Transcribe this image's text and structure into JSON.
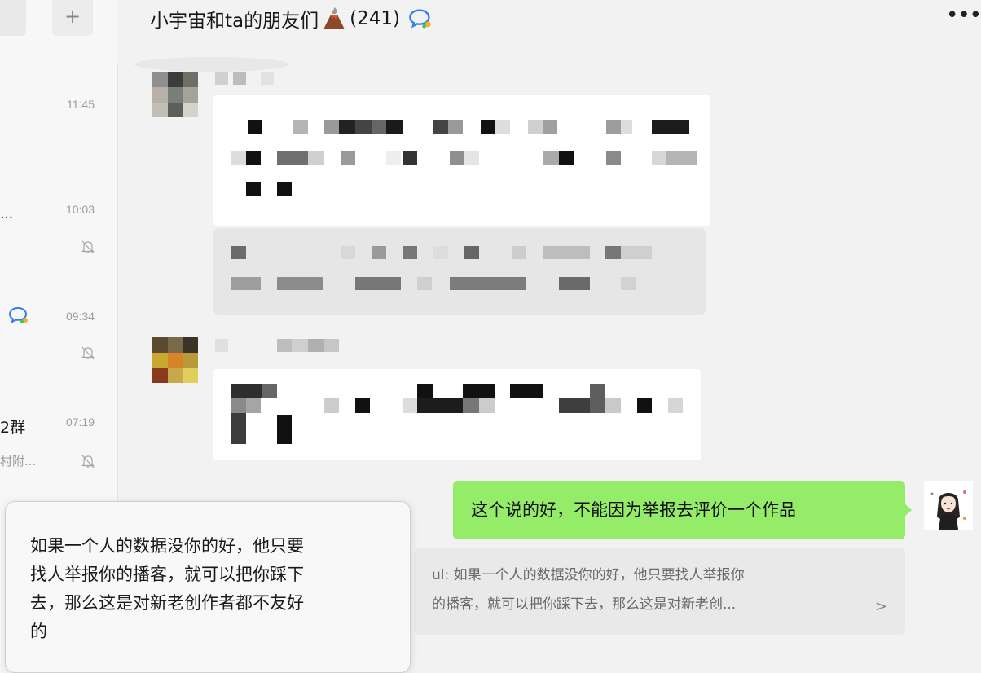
{
  "sidebar": {
    "plus_label": "+",
    "items": [
      {
        "time": "11:45"
      },
      {
        "fragment": "...",
        "time": "10:03"
      },
      {
        "time": "09:34"
      },
      {
        "fragment": "2群",
        "time": "07:19",
        "sub": "村附..."
      }
    ]
  },
  "header": {
    "title": "小宇宙和ta的朋友们",
    "count": "(241)",
    "more": "•••"
  },
  "my_message": {
    "text": "这个说的好，不能因为举报去评价一个作品",
    "quote_line1": "ul: 如果一个人的数据没你的好，他只要找人举报你",
    "quote_line2": "的播客，就可以把你踩下去，那么这是对新老创...",
    "quote_arrow": ">"
  },
  "tooltip": {
    "line1": "如果一个人的数据没你的好，他只要",
    "line2": "找人举报你的播客，就可以把你踩下",
    "line3": "去，那么这是对新老创作者都不友好",
    "line4": "的"
  },
  "colors": {
    "my_bubble": "#95ec69",
    "background": "#f2f2f2",
    "accent_icon": "#2f7df6"
  },
  "icons": [
    "plus-icon",
    "volcano-emoji-icon",
    "chat-bubble-icon",
    "mute-bell-icon",
    "more-icon"
  ]
}
